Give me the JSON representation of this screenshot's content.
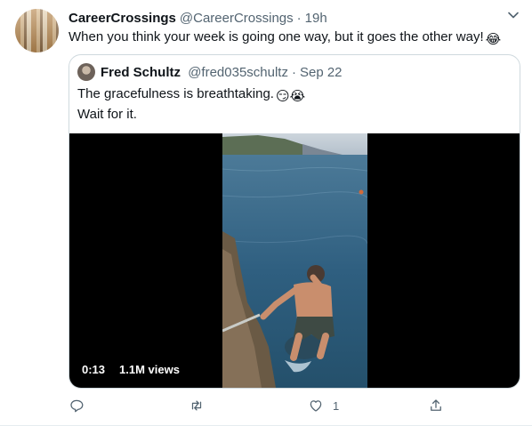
{
  "tweet": {
    "author_name": "CareerCrossings",
    "author_handle": "@CareerCrossings",
    "separator": "·",
    "time": "19h",
    "text": "When you think your week is going one way, but it goes the other way!",
    "text_emoji": "😂"
  },
  "quoted": {
    "author_name": "Fred Schultz",
    "author_handle": "@fred035schultz",
    "separator": "·",
    "date": "Sep 22",
    "line1": "The gracefulness is breathtaking.",
    "line1_emojis": "😏😭",
    "line2": "Wait for it.",
    "video": {
      "duration": "0:13",
      "views": "1.1M views"
    }
  },
  "actions": {
    "reply_count": "",
    "retweet_count": "",
    "like_count": "1",
    "share_count": ""
  },
  "icons": [
    "chevron-down-icon",
    "reply-icon",
    "retweet-icon",
    "like-icon",
    "share-icon"
  ],
  "colors": {
    "text": "#0f1419",
    "secondary": "#536471",
    "border": "#cfd9de"
  }
}
